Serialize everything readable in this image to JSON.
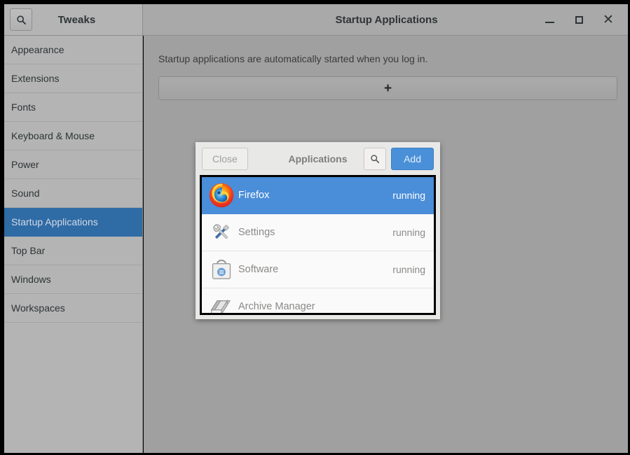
{
  "window": {
    "app_title": "Tweaks",
    "title": "Startup Applications",
    "search_icon": "search-icon",
    "controls": {
      "minimize": "minimize-icon",
      "maximize": "maximize-icon",
      "close": "close-icon"
    }
  },
  "sidebar": {
    "items": [
      {
        "label": "Appearance",
        "selected": false
      },
      {
        "label": "Extensions",
        "selected": false
      },
      {
        "label": "Fonts",
        "selected": false
      },
      {
        "label": "Keyboard & Mouse",
        "selected": false
      },
      {
        "label": "Power",
        "selected": false
      },
      {
        "label": "Sound",
        "selected": false
      },
      {
        "label": "Startup Applications",
        "selected": true
      },
      {
        "label": "Top Bar",
        "selected": false
      },
      {
        "label": "Windows",
        "selected": false
      },
      {
        "label": "Workspaces",
        "selected": false
      }
    ]
  },
  "main": {
    "description": "Startup applications are automatically started when you log in.",
    "add_button_label": "+"
  },
  "dialog": {
    "close_label": "Close",
    "title": "Applications",
    "search_icon": "search-icon",
    "add_label": "Add",
    "applications": [
      {
        "name": "Firefox",
        "state": "running",
        "icon": "firefox-icon",
        "selected": true
      },
      {
        "name": "Settings",
        "state": "running",
        "icon": "settings-tools-icon",
        "selected": false
      },
      {
        "name": "Software",
        "state": "running",
        "icon": "software-bag-icon",
        "selected": false
      },
      {
        "name": "Archive Manager",
        "state": "",
        "icon": "archive-manager-icon",
        "selected": false
      }
    ]
  },
  "colors": {
    "accent_blue": "#4a90d9",
    "selected_row_blue": "#4a8dd8",
    "sidebar_selected_blue": "#2f6ba5",
    "window_bg": "#a0a0a0",
    "sidebar_bg": "#b4b4b4",
    "dialog_bg": "#e8e8e6"
  }
}
